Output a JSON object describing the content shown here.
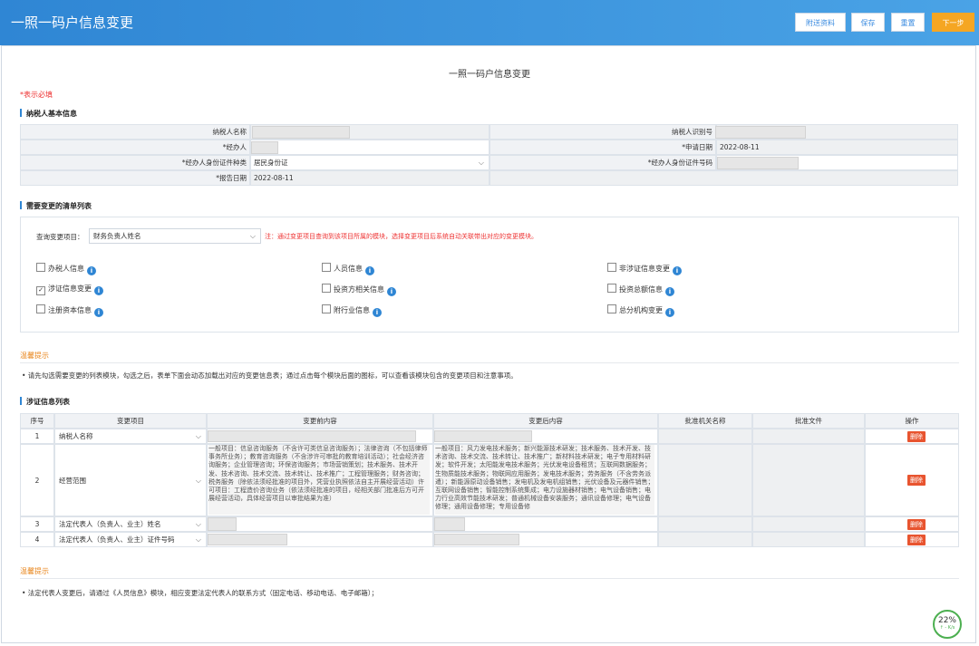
{
  "header": {
    "title": "一照一码户信息变更",
    "buttons": {
      "attach": "附送资料",
      "save": "保存",
      "reset": "重置",
      "next": "下一步"
    }
  },
  "page_title": "一照一码户信息变更",
  "required_note": "*表示必填",
  "basic_section": {
    "title": "纳税人基本信息",
    "taxpayer_name_label": "纳税人名称",
    "taxpayer_id_label": "纳税人识别号",
    "agent_label": "*经办人",
    "apply_date_label": "*申请日期",
    "apply_date": "2022-08-11",
    "id_type_label": "*经办人身份证件种类",
    "id_type_value": "居民身份证",
    "id_no_label": "*经办人身份证件号码",
    "report_date_label": "*报告日期",
    "report_date": "2022-08-11"
  },
  "change_list_section": {
    "title": "需要变更的清单列表",
    "query_label": "查询变更项目：",
    "query_value": "财务负责人姓名",
    "query_note": "注：通过变更项目查询到该项目所属的模块，选择变更项目后系统自动关联带出对应的变更模块。",
    "checkboxes": [
      {
        "label": "办税人信息",
        "checked": false
      },
      {
        "label": "人员信息",
        "checked": false
      },
      {
        "label": "非涉证信息变更",
        "checked": false
      },
      {
        "label": "涉证信息变更",
        "checked": true
      },
      {
        "label": "投资方相关信息",
        "checked": false
      },
      {
        "label": "投资总额信息",
        "checked": false
      },
      {
        "label": "注册资本信息",
        "checked": false
      },
      {
        "label": "附行业信息",
        "checked": false
      },
      {
        "label": "总分机构变更",
        "checked": false
      }
    ]
  },
  "tip1": {
    "title": "温馨提示",
    "text": "• 请先勾选需要变更的列表模块，勾选之后，表单下面会动态加载出对应的变更信息表；通过点击每个模块后面的图标，可以查看该模块包含的变更项目和注意事项。"
  },
  "cert_section": {
    "title": "涉证信息列表",
    "columns": [
      "序号",
      "变更项目",
      "变更前内容",
      "变更后内容",
      "批准机关名称",
      "批准文件",
      "操作"
    ],
    "delete_label": "删除",
    "rows": [
      {
        "no": "1",
        "item": "纳税人名称"
      },
      {
        "no": "2",
        "item": "经营范围",
        "before": "一般项目：信息咨询服务（不含许可类信息咨询服务）；法律咨询（不包括律师事务所业务）；教育咨询服务（不含涉许可审批的教育培训活动）；社会经济咨询服务；企业管理咨询；环保咨询服务；市场营销策划；技术服务、技术开发、技术咨询、技术交流、技术转让、技术推广；工程管理服务；财务咨询；税务服务（除依法须经批准的项目外，凭营业执照依法自主开展经营活动）许可项目：工程造价咨询业务（依法须经批准的项目，经相关部门批准后方可开展经营活动，具体经营项目以审批结果为准）",
        "after": "一般项目：风力发电技术服务；新兴能源技术研发；技术服务、技术开发、技术咨询、技术交流、技术转让、技术推广；新材料技术研发；电子专用材料研发；软件开发；太阳能发电技术服务；光伏发电设备租赁；互联网数据服务；生物质能技术服务；物联网应用服务；发电技术服务；劳务服务（不含劳务派遣）；新能源原动设备销售；发电机及发电机组销售；光伏设备及元器件销售；互联网设备销售；智能控制系统集成；电力设施器材销售；电气设备销售；电力行业高效节能技术研发；普通机械设备安装服务；通讯设备修理；电气设备修理；通用设备修理；专用设备修"
      },
      {
        "no": "3",
        "item": "法定代表人（负责人、业主）姓名"
      },
      {
        "no": "4",
        "item": "法定代表人（负责人、业主）证件号码"
      }
    ]
  },
  "tip2": {
    "title": "温馨提示",
    "text": "• 法定代表人变更后，请通过《人员信息》模块，相应变更法定代表人的联系方式（固定电话、移动电话、电子邮箱）；"
  },
  "progress_widget": {
    "percent": "22%",
    "speed": "↑ - K/s"
  }
}
